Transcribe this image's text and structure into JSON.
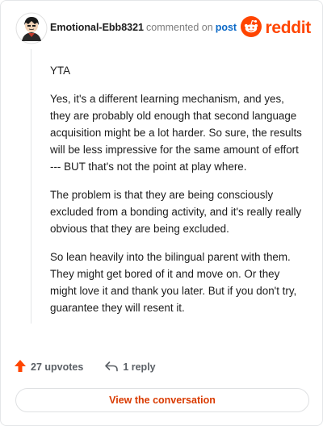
{
  "header": {
    "username": "Emotional-Ebb8321",
    "commented_text": "commented on",
    "post_link": "post",
    "brand": "reddit"
  },
  "comment": {
    "paragraphs": [
      "YTA",
      "Yes, it's a different learning mechanism, and yes, they are probably old enough that second language acquisition might be a lot harder. So sure, the results will be less impressive for the same amount of effort --- BUT that's not the point at play where.",
      "The problem is that they are being consciously excluded from a bonding activity, and it's really really obvious that they are being excluded.",
      "So lean heavily into the bilingual parent with them. They might get bored of it and move on. Or they might love it and thank you later. But if you don't try, guarantee they will resent it."
    ]
  },
  "actions": {
    "upvotes": "27 upvotes",
    "replies": "1 reply"
  },
  "cta": {
    "label": "View the conversation"
  },
  "colors": {
    "brand": "#ff4500",
    "link": "#0b69c7",
    "cta_text": "#d93a00"
  },
  "icons": [
    "avatar",
    "reddit-logo-icon",
    "upvote-arrow-icon",
    "reply-icon"
  ]
}
